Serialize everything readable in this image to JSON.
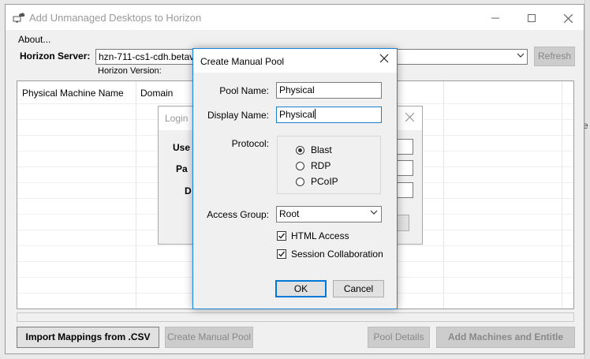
{
  "main_window": {
    "title": "Add Unmanaged Desktops to Horizon",
    "menu_about": "About...",
    "horizon_server_label": "Horizon Server:",
    "horizon_server_value": "hzn-711-cs1-cdh.betavm",
    "horizon_version_label": "Horizon Version:",
    "refresh_label": "Refresh",
    "table_columns": [
      "Physical Machine Name",
      "Domain"
    ],
    "buttons": {
      "import_mappings": "Import Mappings from .CSV",
      "create_manual_pool": "Create Manual Pool",
      "pool_details": "Pool Details",
      "add_machines_and_entitle": "Add Machines and Entitle"
    }
  },
  "login_dialog": {
    "title": "Login",
    "labels": [
      "Use",
      "Pa",
      "D"
    ],
    "cancel_partial": "l"
  },
  "pool_dialog": {
    "title": "Create Manual Pool",
    "pool_name_label": "Pool Name:",
    "pool_name_value": "Physical",
    "display_name_label": "Display Name:",
    "display_name_value": "Physical",
    "protocol_label": "Protocol:",
    "protocols": [
      {
        "label": "Blast",
        "selected": true
      },
      {
        "label": "RDP",
        "selected": false
      },
      {
        "label": "PCoIP",
        "selected": false
      }
    ],
    "access_group_label": "Access Group:",
    "access_group_value": "Root",
    "html_access": {
      "label": "HTML Access",
      "checked": true
    },
    "session_collaboration": {
      "label": "Session Collaboration",
      "checked": true
    },
    "ok_label": "OK",
    "cancel_label": "Cancel"
  },
  "background": {
    "right_edge_text": "e"
  },
  "icons": {
    "app": "desktop-cloud-icon",
    "minimize": "minimize-icon",
    "maximize": "maximize-icon",
    "close": "close-icon",
    "dropdown": "chevron-down-icon",
    "checkbox": "checkmark-icon"
  },
  "colors": {
    "accent": "#0078d7",
    "dialog_border": "#1883d7",
    "disabled_button": "#cccccc",
    "window_bg": "#f0f0f0"
  }
}
